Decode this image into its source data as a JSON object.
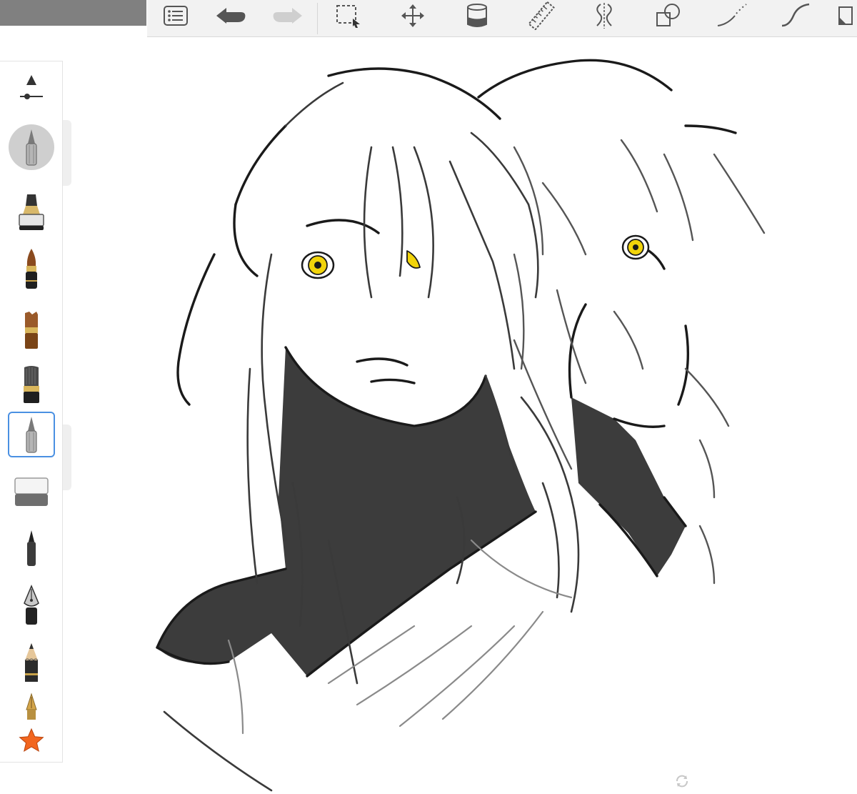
{
  "app": {
    "accent_color": "#4a90e2",
    "menu_strip_color": "#808080",
    "toolbar_background": "#f2f2f2"
  },
  "toolbar": {
    "tools": [
      {
        "name": "layers-list",
        "icon": "list-icon"
      },
      {
        "name": "undo",
        "icon": "undo-arrow-icon"
      },
      {
        "name": "redo",
        "icon": "redo-arrow-icon",
        "state": "disabled"
      },
      {
        "name": "selection",
        "icon": "marquee-select-icon"
      },
      {
        "name": "transform",
        "icon": "move-arrows-icon"
      },
      {
        "name": "fill",
        "icon": "paint-bucket-icon"
      },
      {
        "name": "ruler",
        "icon": "ruler-icon"
      },
      {
        "name": "symmetry",
        "icon": "symmetry-icon"
      },
      {
        "name": "shapes",
        "icon": "shapes-icon"
      },
      {
        "name": "predictive-stroke",
        "icon": "dotted-curve-icon"
      },
      {
        "name": "steady-stroke",
        "icon": "s-curve-icon"
      },
      {
        "name": "more",
        "icon": "panel-corner-icon"
      }
    ]
  },
  "brush_panel": {
    "brushes": [
      {
        "name": "size-opacity-slider",
        "icon": "size-slider-icon"
      },
      {
        "name": "ballpoint-pen-active",
        "icon": "ballpoint-pen-icon",
        "state": "highlighted"
      },
      {
        "name": "marker",
        "icon": "marker-icon"
      },
      {
        "name": "paint-brush",
        "icon": "paint-brush-icon"
      },
      {
        "name": "flat-brush",
        "icon": "flat-brush-icon"
      },
      {
        "name": "round-brush",
        "icon": "round-brush-icon"
      },
      {
        "name": "ballpoint-pen",
        "icon": "ballpoint-pen-icon",
        "state": "selected"
      },
      {
        "name": "eraser",
        "icon": "eraser-icon"
      },
      {
        "name": "felt-pen",
        "icon": "felt-pen-icon"
      },
      {
        "name": "fountain-pen",
        "icon": "fountain-pen-icon"
      },
      {
        "name": "pencil",
        "icon": "pencil-icon"
      },
      {
        "name": "nib",
        "icon": "nib-icon"
      },
      {
        "name": "favorites",
        "icon": "star-icon",
        "color": "#f2661f"
      }
    ]
  },
  "canvas": {
    "eye_color": "#f2d40a",
    "fill_color": "#3c3c3c"
  }
}
